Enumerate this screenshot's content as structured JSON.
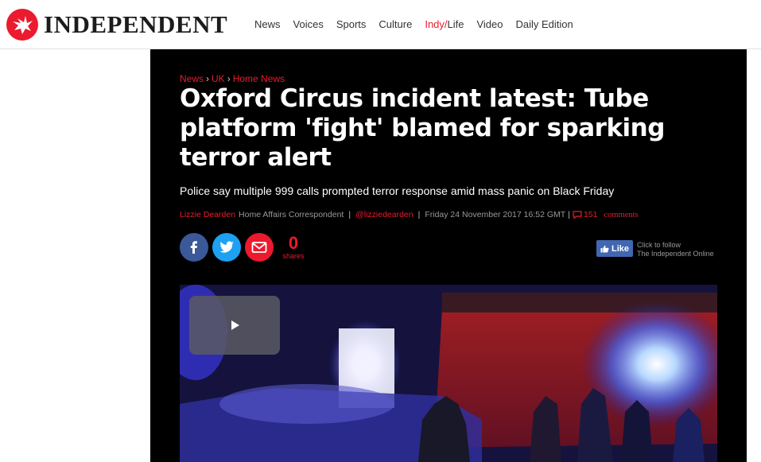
{
  "brand": {
    "name": "INDEPENDENT"
  },
  "nav": {
    "items": [
      "News",
      "Voices",
      "Sports",
      "Culture"
    ],
    "indy_prefix": "Indy/",
    "indy_suffix": "Life",
    "video": "Video",
    "daily": "Daily Edition"
  },
  "breadcrumb": [
    "News",
    "UK",
    "Home News"
  ],
  "article": {
    "headline": "Oxford Circus incident latest: Tube platform 'fight' blamed for sparking terror alert",
    "standfirst": "Police say multiple 999 calls prompted terror response amid mass panic on Black Friday",
    "author": "Lizzie Dearden",
    "author_role": "Home Affairs Correspondent",
    "twitter": "@lizziedearden",
    "date": "Friday 24 November 2017 16:52 GMT",
    "comments_count": "151",
    "comments_label": "comments"
  },
  "share": {
    "count": "0",
    "label": "shares"
  },
  "facebook": {
    "like_label": "Like",
    "follow_line1": "Click to follow",
    "follow_line2": "The Independent Online"
  },
  "colors": {
    "brand_red": "#ec1a2e",
    "facebook_blue": "#4267b2",
    "twitter_blue": "#1da1f2",
    "facebook_circle": "#3b5998"
  }
}
